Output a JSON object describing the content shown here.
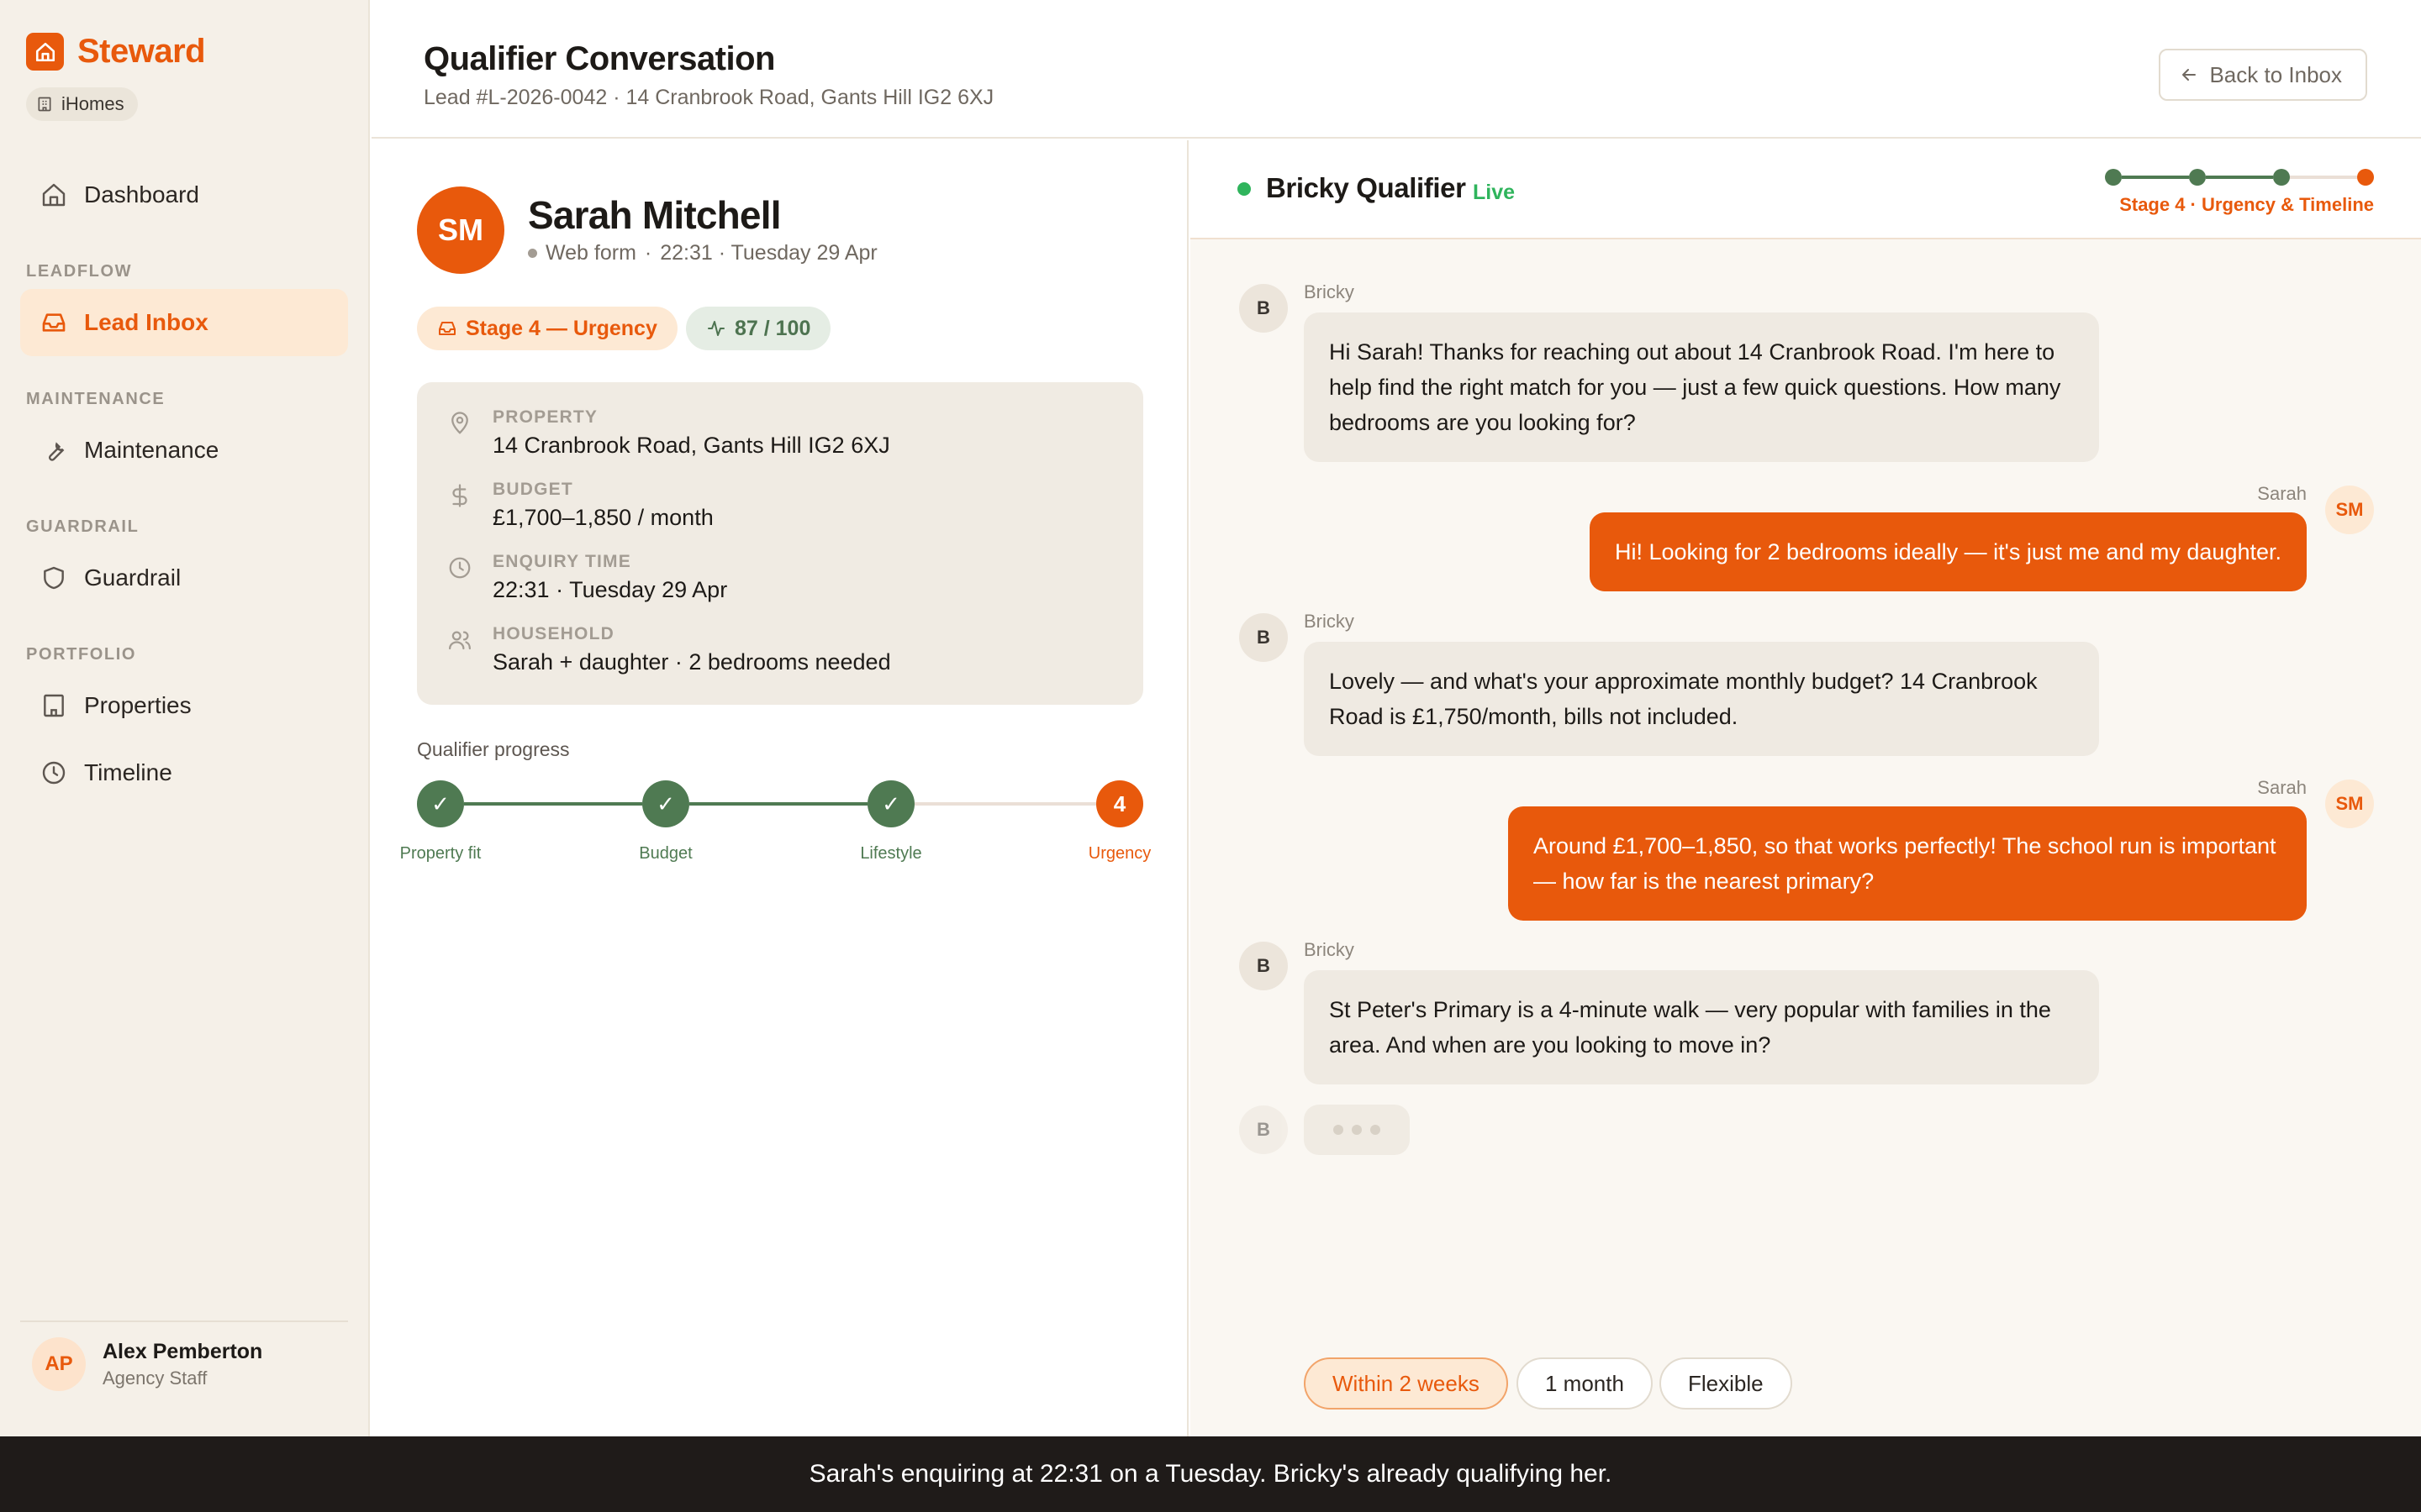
{
  "brand": {
    "name": "Steward",
    "org": "iHomes"
  },
  "sidebar": {
    "dashboard": "Dashboard",
    "sections": {
      "leadflow": "LEADFLOW",
      "maintenance": "MAINTENANCE",
      "guardrail": "GUARDRAIL",
      "portfolio": "PORTFOLIO"
    },
    "items": {
      "lead_inbox": "Lead Inbox",
      "maintenance": "Maintenance",
      "guardrail": "Guardrail",
      "properties": "Properties",
      "timeline": "Timeline"
    },
    "active": "lead_inbox",
    "user": {
      "initials": "AP",
      "name": "Alex Pemberton",
      "role": "Agency Staff"
    }
  },
  "header": {
    "title": "Qualifier Conversation",
    "subtitle": "Lead #L-2026-0042 · 14 Cranbrook Road, Gants Hill IG2 6XJ",
    "back_label": "Back to Inbox"
  },
  "lead": {
    "initials": "SM",
    "name": "Sarah Mitchell",
    "source": "Web form",
    "separator": "·",
    "time": "22:31 · Tuesday 29 Apr",
    "stage_chip": "Stage 4 — Urgency",
    "score_chip": "87 / 100",
    "details": {
      "property_label": "PROPERTY",
      "property_value": "14 Cranbrook Road, Gants Hill IG2 6XJ",
      "budget_label": "BUDGET",
      "budget_value": "£1,700–1,850 / month",
      "enquiry_label": "ENQUIRY TIME",
      "enquiry_value": "22:31 · Tuesday 29 Apr",
      "household_label": "HOUSEHOLD",
      "household_value": "Sarah + daughter · 2 bedrooms needed"
    },
    "progress": {
      "title": "Qualifier progress",
      "check": "✓",
      "current_number": "4",
      "steps": [
        "Property fit",
        "Budget",
        "Lifestyle",
        "Urgency"
      ],
      "completed_steps": 3
    }
  },
  "chat": {
    "bot_name": "Bricky Qualifier",
    "status": "Live",
    "stage_caption": "Stage 4 · Urgency & Timeline",
    "bot_initial": "B",
    "user_initials": "SM",
    "messages": [
      {
        "from": "bot",
        "sender": "Bricky",
        "text": "Hi Sarah! Thanks for reaching out about 14 Cranbrook Road. I'm here to help find the right match for you — just a few quick questions. How many bedrooms are you looking for?"
      },
      {
        "from": "user",
        "sender": "Sarah",
        "text": "Hi! Looking for 2 bedrooms ideally — it's just me and my daughter."
      },
      {
        "from": "bot",
        "sender": "Bricky",
        "text": "Lovely — and what's your approximate monthly budget? 14 Cranbrook Road is £1,750/month, bills not included."
      },
      {
        "from": "user",
        "sender": "Sarah",
        "text": "Around £1,700–1,850, so that works perfectly! The school run is important — how far is the nearest primary?"
      },
      {
        "from": "bot",
        "sender": "Bricky",
        "text": "St Peter's Primary is a 4-minute walk — very popular with families in the area. And when are you looking to move in?"
      }
    ],
    "quick_replies": [
      "Within 2 weeks",
      "1 month",
      "Flexible"
    ]
  },
  "banner": {
    "text": "Sarah's enquiring at 22:31 on a Tuesday. Bricky's already qualifying her."
  },
  "colors": {
    "accent": "#e8590c",
    "success": "#4f7a52",
    "live": "#2fb45c",
    "sidebar_bg": "#f5f0e8"
  },
  "icons": {
    "brand": "house-icon",
    "org": "building-icon",
    "dashboard": "home-icon",
    "lead_inbox": "inbox-icon",
    "maintenance": "wrench-icon",
    "guardrail": "shield-icon",
    "properties": "building-icon",
    "timeline": "clock-icon",
    "back": "arrow-left-icon",
    "stage": "inbox-icon",
    "score": "activity-icon",
    "property": "map-pin-icon",
    "budget": "dollar-icon",
    "enquiry": "clock-icon",
    "household": "users-icon"
  }
}
